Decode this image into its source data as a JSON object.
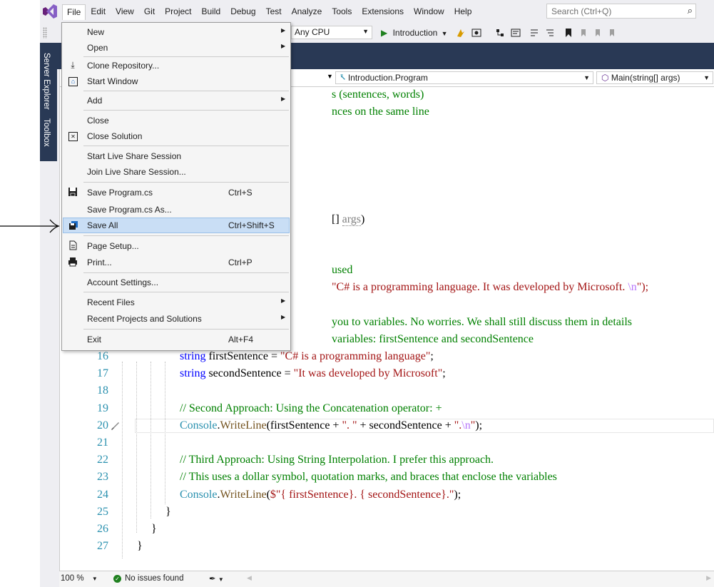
{
  "menubar": {
    "items": [
      "File",
      "Edit",
      "View",
      "Git",
      "Project",
      "Build",
      "Debug",
      "Test",
      "Analyze",
      "Tools",
      "Extensions",
      "Window",
      "Help"
    ],
    "search_placeholder": "Search (Ctrl+Q)"
  },
  "toolbar": {
    "platform": "Any CPU",
    "run_target": "Introduction"
  },
  "sidebar": {
    "tabs": [
      "Server Explorer",
      "Toolbox"
    ]
  },
  "navbar": {
    "class_dropdown": "Introduction.Program",
    "member_dropdown": "Main(string[] args)"
  },
  "file_menu": {
    "items": [
      {
        "label": "New",
        "shortcut": "",
        "submenu": true,
        "icon": ""
      },
      {
        "label": "Open",
        "shortcut": "",
        "submenu": true,
        "icon": ""
      },
      {
        "label": "Clone Repository...",
        "shortcut": "",
        "submenu": false,
        "icon": "clone-icon"
      },
      {
        "label": "Start Window",
        "shortcut": "",
        "submenu": false,
        "icon": "start-window-icon"
      },
      {
        "label": "Add",
        "shortcut": "",
        "submenu": true,
        "icon": ""
      },
      {
        "label": "Close",
        "shortcut": "",
        "submenu": false,
        "icon": ""
      },
      {
        "label": "Close Solution",
        "shortcut": "",
        "submenu": false,
        "icon": "close-solution-icon"
      },
      {
        "label": "Start Live Share Session",
        "shortcut": "",
        "submenu": false,
        "icon": ""
      },
      {
        "label": "Join Live Share Session...",
        "shortcut": "",
        "submenu": false,
        "icon": ""
      },
      {
        "label": "Save Program.cs",
        "shortcut": "Ctrl+S",
        "submenu": false,
        "icon": "save-icon"
      },
      {
        "label": "Save Program.cs As...",
        "shortcut": "",
        "submenu": false,
        "icon": ""
      },
      {
        "label": "Save All",
        "shortcut": "Ctrl+Shift+S",
        "submenu": false,
        "icon": "save-all-icon"
      },
      {
        "label": "Page Setup...",
        "shortcut": "",
        "submenu": false,
        "icon": "page-setup-icon"
      },
      {
        "label": "Print...",
        "shortcut": "Ctrl+P",
        "submenu": false,
        "icon": "print-icon"
      },
      {
        "label": "Account Settings...",
        "shortcut": "",
        "submenu": false,
        "icon": ""
      },
      {
        "label": "Recent Files",
        "shortcut": "",
        "submenu": true,
        "icon": ""
      },
      {
        "label": "Recent Projects and Solutions",
        "shortcut": "",
        "submenu": true,
        "icon": ""
      },
      {
        "label": "Exit",
        "shortcut": "Alt+F4",
        "submenu": false,
        "icon": ""
      }
    ],
    "highlighted": "Save All"
  },
  "code": {
    "partial": {
      "l1": "s (sentences, words)",
      "l2": "nces on the same line",
      "l3a": "[] ",
      "l3b": "args",
      "l3c": ")",
      "l4": "used",
      "l5a": "\"C# is a programming language. It was developed by Microsoft. ",
      "l5b": "\\n",
      "l5c": "\");",
      "l6": " you to variables. No worries. We shall still discuss them in details",
      "l7": "variables: firstSentence and secondSentence"
    },
    "line_numbers": [
      "16",
      "17",
      "18",
      "19",
      "20",
      "21",
      "22",
      "23",
      "24",
      "25",
      "26",
      "27"
    ],
    "lines": {
      "l16_kw": "string",
      "l16_rest": " firstSentence = ",
      "l16_str": "\"C# is a programming language\"",
      "l16_end": ";",
      "l17_kw": "string",
      "l17_rest": " secondSentence = ",
      "l17_str": "\"It was developed by Microsoft\"",
      "l17_end": ";",
      "l19": "// Second Approach: Using the Concatenation operator: +",
      "l20_cls": "Console",
      "l20_dot": ".",
      "l20_mt": "WriteLine",
      "l20_a": "(firstSentence + ",
      "l20_s1": "\". \"",
      "l20_b": " + secondSentence + ",
      "l20_s2a": "\".",
      "l20_esc": "\\n",
      "l20_s2b": "\"",
      "l20_end": ");",
      "l22": "// Third Approach: Using String Interpolation. I prefer this approach.",
      "l23": "// This uses a dollar symbol, quotation marks, and braces that enclose the variables",
      "l24_cls": "Console",
      "l24_dot": ".",
      "l24_mt": "WriteLine",
      "l24_p": "(",
      "l24_s1": "$\"",
      "l24_b1": "{ firstSentence}",
      "l24_s2": ". ",
      "l24_b2": "{ secondSentence}",
      "l24_s3": ".\"",
      "l24_end": ");",
      "l25": "}",
      "l26": "}",
      "l27": "}"
    }
  },
  "statusbar": {
    "zoom": "100 %",
    "issues": "No issues found"
  },
  "colors": {
    "accent": "#68217a",
    "band": "#293955",
    "menu_highlight": "#c9def5"
  }
}
